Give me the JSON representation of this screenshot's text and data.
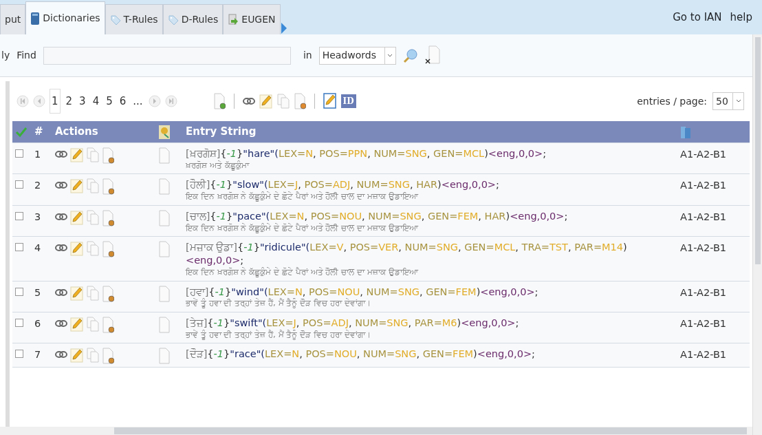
{
  "tabs": [
    {
      "label": "put",
      "selected": false
    },
    {
      "label": "Dictionaries",
      "selected": true
    },
    {
      "label": "T-Rules",
      "selected": false
    },
    {
      "label": "D-Rules",
      "selected": false
    },
    {
      "label": "EUGEN",
      "selected": false
    }
  ],
  "header_links": [
    "Go to IAN",
    "help"
  ],
  "search": {
    "cut_label": "ly",
    "find_label": "Find",
    "in_label": "in",
    "field": "Headwords"
  },
  "pager": {
    "pages": [
      {
        "label": "1",
        "selected": true
      },
      {
        "label": "2",
        "selected": false
      },
      {
        "label": "3",
        "selected": false
      },
      {
        "label": "4",
        "selected": false
      },
      {
        "label": "5",
        "selected": false
      },
      {
        "label": "6",
        "selected": false
      }
    ],
    "more": "..."
  },
  "toolbar": {
    "id_badge": "ID"
  },
  "page_size": {
    "label": "entries / page:",
    "value": "50"
  },
  "table": {
    "columns": [
      "#",
      "Actions",
      "Entry String"
    ],
    "rows": [
      {
        "number": "1",
        "checked": false,
        "level": "A1-A2-B1",
        "example": "ਖ਼ਰਗੋਸ਼ ਅਤੇ ਕੱਛੂਕੁੰਮਾ",
        "segments": [
          {
            "kind": "head",
            "text": "[ਖ਼ਰਗੋਸ਼]"
          },
          {
            "kind": "punct",
            "text": "{"
          },
          {
            "kind": "index",
            "text": "-1"
          },
          {
            "kind": "punct",
            "text": "}"
          },
          {
            "kind": "word",
            "text": "\"hare\"("
          },
          {
            "kind": "key",
            "text": "LEX="
          },
          {
            "kind": "value",
            "text": "N"
          },
          {
            "kind": "punct",
            "text": ", "
          },
          {
            "kind": "key",
            "text": "POS="
          },
          {
            "kind": "value",
            "text": "PPN"
          },
          {
            "kind": "punct",
            "text": ", "
          },
          {
            "kind": "key",
            "text": "NUM="
          },
          {
            "kind": "value",
            "text": "SNG"
          },
          {
            "kind": "punct",
            "text": ", "
          },
          {
            "kind": "key",
            "text": "GEN="
          },
          {
            "kind": "value",
            "text": "MCL"
          },
          {
            "kind": "punct",
            "text": ")"
          },
          {
            "kind": "lang",
            "text": "<eng,0,0>"
          },
          {
            "kind": "punct",
            "text": ";"
          }
        ]
      },
      {
        "number": "2",
        "checked": false,
        "level": "A1-A2-B1",
        "example": "ਇਕ ਦਿਨ ਖ਼ਰਗੋਸ਼ ਨੇ ਕੱਛੂਕੁੰਮੇ ਦੇ ਛੋਟੇ ਪੈਰਾਂ ਅਤੇ ਹੌਲੀ ਚਾਲ ਦਾ ਮਜ਼ਾਕ ਉਡਾਇਆ",
        "segments": [
          {
            "kind": "head",
            "text": "[ਹੌਲੀ]"
          },
          {
            "kind": "punct",
            "text": "{"
          },
          {
            "kind": "index",
            "text": "-1"
          },
          {
            "kind": "punct",
            "text": "}"
          },
          {
            "kind": "word",
            "text": "\"slow\"("
          },
          {
            "kind": "key",
            "text": "LEX="
          },
          {
            "kind": "value",
            "text": "J"
          },
          {
            "kind": "punct",
            "text": ", "
          },
          {
            "kind": "key",
            "text": "POS="
          },
          {
            "kind": "value",
            "text": "ADJ"
          },
          {
            "kind": "punct",
            "text": ", "
          },
          {
            "kind": "key",
            "text": "NUM="
          },
          {
            "kind": "value",
            "text": "SNG"
          },
          {
            "kind": "punct",
            "text": ", "
          },
          {
            "kind": "key",
            "text": "HAR"
          },
          {
            "kind": "punct",
            "text": ")"
          },
          {
            "kind": "lang",
            "text": "<eng,0,0>"
          },
          {
            "kind": "punct",
            "text": ";"
          }
        ]
      },
      {
        "number": "3",
        "checked": false,
        "level": "A1-A2-B1",
        "example": "ਇਕ ਦਿਨ ਖ਼ਰਗੋਸ਼ ਨੇ ਕੱਛੂਕੁੰਮੇ ਦੇ ਛੋਟੇ ਪੈਰਾਂ ਅਤੇ ਹੌਲੀ ਚਾਲ ਦਾ ਮਜ਼ਾਕ ਉਡਾਇਆ",
        "segments": [
          {
            "kind": "head",
            "text": "[ਚਾਲ]"
          },
          {
            "kind": "punct",
            "text": "{"
          },
          {
            "kind": "index",
            "text": "-1"
          },
          {
            "kind": "punct",
            "text": "}"
          },
          {
            "kind": "word",
            "text": "\"pace\"("
          },
          {
            "kind": "key",
            "text": "LEX="
          },
          {
            "kind": "value",
            "text": "N"
          },
          {
            "kind": "punct",
            "text": ", "
          },
          {
            "kind": "key",
            "text": "POS="
          },
          {
            "kind": "value",
            "text": "NOU"
          },
          {
            "kind": "punct",
            "text": ", "
          },
          {
            "kind": "key",
            "text": "NUM="
          },
          {
            "kind": "value",
            "text": "SNG"
          },
          {
            "kind": "punct",
            "text": ", "
          },
          {
            "kind": "key",
            "text": "GEN="
          },
          {
            "kind": "value",
            "text": "FEM"
          },
          {
            "kind": "punct",
            "text": ", "
          },
          {
            "kind": "key",
            "text": "HAR"
          },
          {
            "kind": "punct",
            "text": ")"
          },
          {
            "kind": "lang",
            "text": "<eng,0,0>"
          },
          {
            "kind": "punct",
            "text": ";"
          }
        ]
      },
      {
        "number": "4",
        "checked": false,
        "level": "A1-A2-B1",
        "example": "ਇਕ ਦਿਨ ਖ਼ਰਗੋਸ਼ ਨੇ ਕੱਛੂਕੁੰਮੇ ਦੇ ਛੋਟੇ ਪੈਰਾਂ ਅਤੇ ਹੌਲੀ ਚਾਲ ਦਾ ਮਜ਼ਾਕ ਉਡਾਇਆ",
        "segments": [
          {
            "kind": "head",
            "text": "[ਮਜ਼ਾਕ ਉਡਾ]"
          },
          {
            "kind": "punct",
            "text": "{"
          },
          {
            "kind": "index",
            "text": "-1"
          },
          {
            "kind": "punct",
            "text": "}"
          },
          {
            "kind": "word",
            "text": "\"ridicule\"("
          },
          {
            "kind": "key",
            "text": "LEX="
          },
          {
            "kind": "value",
            "text": "V"
          },
          {
            "kind": "punct",
            "text": ", "
          },
          {
            "kind": "key",
            "text": "POS="
          },
          {
            "kind": "value",
            "text": "VER"
          },
          {
            "kind": "punct",
            "text": ", "
          },
          {
            "kind": "key",
            "text": "NUM="
          },
          {
            "kind": "value",
            "text": "SNG"
          },
          {
            "kind": "punct",
            "text": ", "
          },
          {
            "kind": "key",
            "text": "GEN="
          },
          {
            "kind": "value",
            "text": "MCL"
          },
          {
            "kind": "punct",
            "text": ", "
          },
          {
            "kind": "key",
            "text": "TRA="
          },
          {
            "kind": "value",
            "text": "TST"
          },
          {
            "kind": "punct",
            "text": ", "
          },
          {
            "kind": "key",
            "text": "PAR="
          },
          {
            "kind": "value",
            "text": "M14"
          },
          {
            "kind": "punct",
            "text": ")"
          },
          {
            "kind": "lang",
            "text": "<eng,0,0>"
          },
          {
            "kind": "punct",
            "text": ";"
          }
        ]
      },
      {
        "number": "5",
        "checked": false,
        "level": "A1-A2-B1",
        "example": "ਭਾਵੇਂ ਤੂੰ ਹਵਾ ਦੀ ਤਰ੍ਹਾਂ ਤੇਜ਼ ਹੈਂ, ਮੈਂ ਤੈਨੂੰ ਦੌੜ ਵਿਚ ਹਰਾ ਦੇਵਾਂਗਾ।",
        "segments": [
          {
            "kind": "head",
            "text": "[ਹਵਾ]"
          },
          {
            "kind": "punct",
            "text": "{"
          },
          {
            "kind": "index",
            "text": "-1"
          },
          {
            "kind": "punct",
            "text": "}"
          },
          {
            "kind": "word",
            "text": "\"wind\"("
          },
          {
            "kind": "key",
            "text": "LEX="
          },
          {
            "kind": "value",
            "text": "N"
          },
          {
            "kind": "punct",
            "text": ", "
          },
          {
            "kind": "key",
            "text": "POS="
          },
          {
            "kind": "value",
            "text": "NOU"
          },
          {
            "kind": "punct",
            "text": ", "
          },
          {
            "kind": "key",
            "text": "NUM="
          },
          {
            "kind": "value",
            "text": "SNG"
          },
          {
            "kind": "punct",
            "text": ", "
          },
          {
            "kind": "key",
            "text": "GEN="
          },
          {
            "kind": "value",
            "text": "FEM"
          },
          {
            "kind": "punct",
            "text": ")"
          },
          {
            "kind": "lang",
            "text": "<eng,0,0>"
          },
          {
            "kind": "punct",
            "text": ";"
          }
        ]
      },
      {
        "number": "6",
        "checked": false,
        "level": "A1-A2-B1",
        "example": "ਭਾਵੇਂ ਤੂੰ ਹਵਾ ਦੀ ਤਰ੍ਹਾਂ ਤੇਜ਼ ਹੈਂ, ਮੈਂ ਤੈਨੂੰ ਦੌੜ ਵਿਚ ਹਰਾ ਦੇਵਾਂਗਾ।",
        "segments": [
          {
            "kind": "head",
            "text": "[ਤੇਜ਼]"
          },
          {
            "kind": "punct",
            "text": "{"
          },
          {
            "kind": "index",
            "text": "-1"
          },
          {
            "kind": "punct",
            "text": "}"
          },
          {
            "kind": "word",
            "text": "\"swift\"("
          },
          {
            "kind": "key",
            "text": "LEX="
          },
          {
            "kind": "value",
            "text": "J"
          },
          {
            "kind": "punct",
            "text": ", "
          },
          {
            "kind": "key",
            "text": "POS="
          },
          {
            "kind": "value",
            "text": "ADJ"
          },
          {
            "kind": "punct",
            "text": ", "
          },
          {
            "kind": "key",
            "text": "NUM="
          },
          {
            "kind": "value",
            "text": "SNG"
          },
          {
            "kind": "punct",
            "text": ", "
          },
          {
            "kind": "key",
            "text": "PAR="
          },
          {
            "kind": "value",
            "text": "M6"
          },
          {
            "kind": "punct",
            "text": ")"
          },
          {
            "kind": "lang",
            "text": "<eng,0,0>"
          },
          {
            "kind": "punct",
            "text": ";"
          }
        ]
      },
      {
        "number": "7",
        "checked": false,
        "level": "A1-A2-B1",
        "segments": [
          {
            "kind": "head",
            "text": "[ਦੌੜ]"
          },
          {
            "kind": "punct",
            "text": "{"
          },
          {
            "kind": "index",
            "text": "-1"
          },
          {
            "kind": "punct",
            "text": "}"
          },
          {
            "kind": "word",
            "text": "\"race\"("
          },
          {
            "kind": "key",
            "text": "LEX="
          },
          {
            "kind": "value",
            "text": "N"
          },
          {
            "kind": "punct",
            "text": ", "
          },
          {
            "kind": "key",
            "text": "POS="
          },
          {
            "kind": "value",
            "text": "NOU"
          },
          {
            "kind": "punct",
            "text": ", "
          },
          {
            "kind": "key",
            "text": "NUM="
          },
          {
            "kind": "value",
            "text": "SNG"
          },
          {
            "kind": "punct",
            "text": ", "
          },
          {
            "kind": "key",
            "text": "GEN="
          },
          {
            "kind": "value",
            "text": "FEM"
          },
          {
            "kind": "punct",
            "text": ")"
          },
          {
            "kind": "lang",
            "text": "<eng,0,0>"
          },
          {
            "kind": "punct",
            "text": ";"
          }
        ]
      }
    ]
  }
}
